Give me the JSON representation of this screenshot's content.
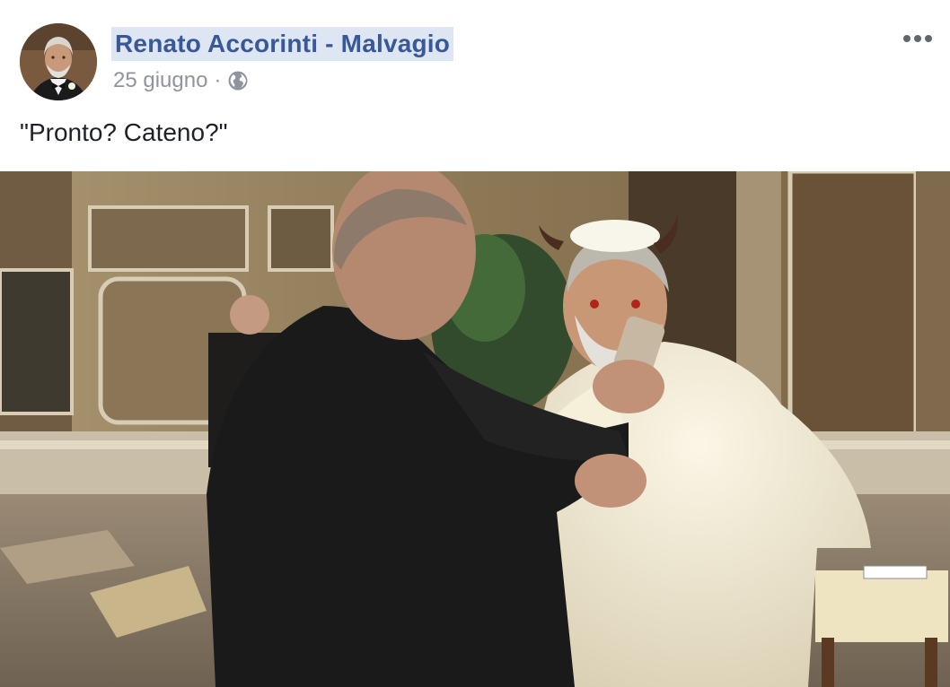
{
  "post": {
    "author": "Renato Accorinti - Malvagio",
    "date": "25 giugno",
    "separator": "·",
    "privacy_icon": "globe-icon",
    "more_icon": "more-options-icon",
    "text": "\"Pronto? Cateno?\""
  },
  "colors": {
    "author_link": "#385898",
    "author_highlight": "#dfe6f3",
    "meta_text": "#90949c",
    "body_text": "#1d2129"
  }
}
